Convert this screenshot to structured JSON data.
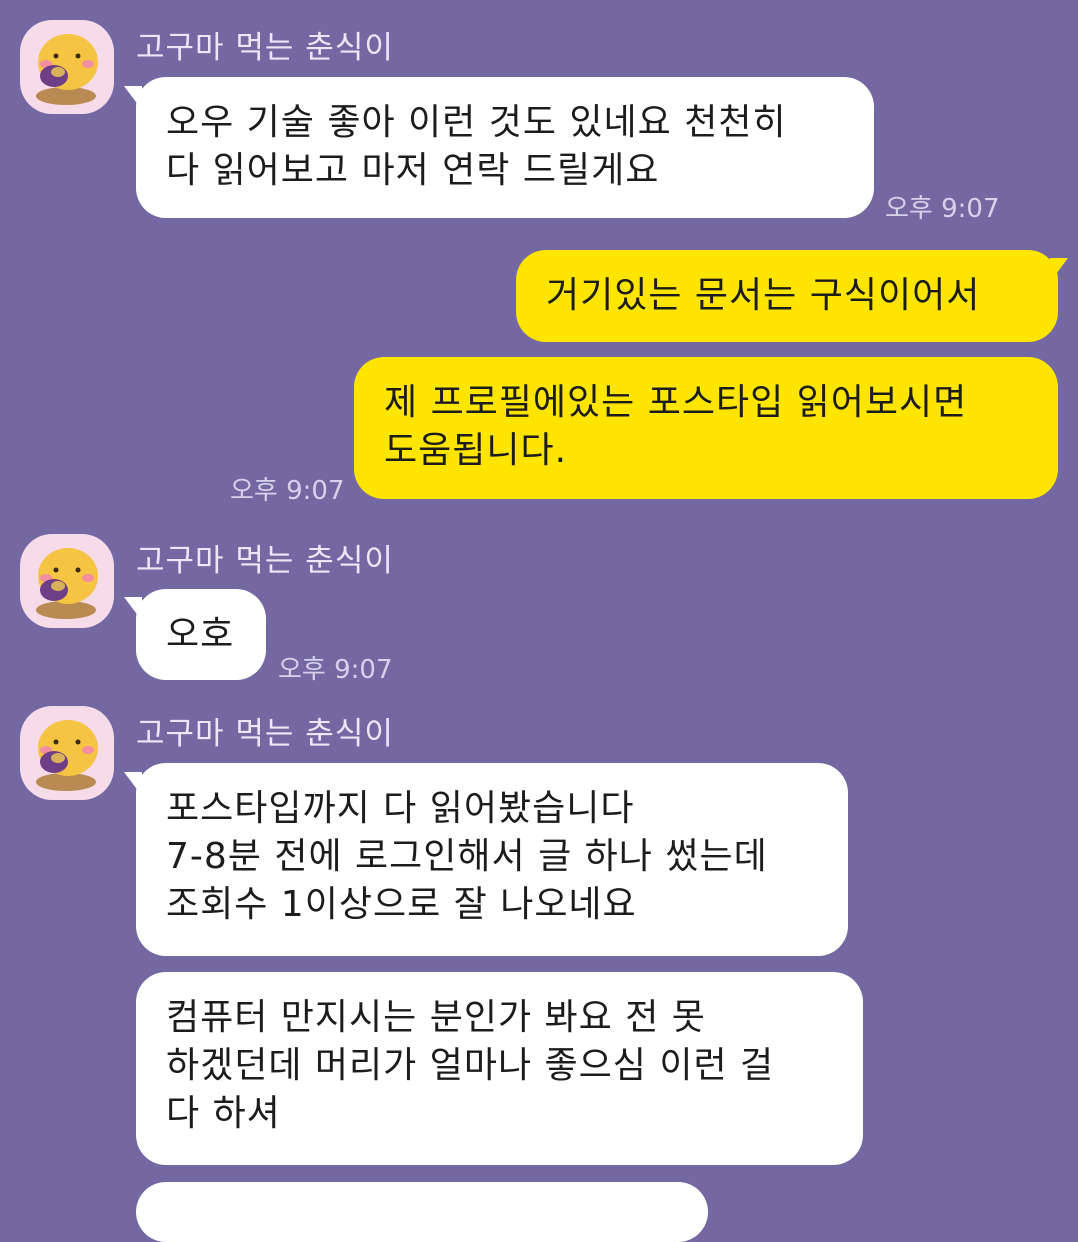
{
  "partner": {
    "name": "고구마 먹는 춘식이",
    "avatar_icon": "choonsik-sweet-potato-icon"
  },
  "messages": [
    {
      "side": "in",
      "text": "오우 기술 좋아 이런 것도 있네요 천천히\n다 읽어보고 마저 연락 드릴게요",
      "time": "오후 9:07"
    },
    {
      "side": "out",
      "text": "거기있는 문서는 구식이어서"
    },
    {
      "side": "out",
      "text": "제 프로필에있는 포스타입 읽어보시면\n도움됩니다.",
      "time": "오후 9:07"
    },
    {
      "side": "in",
      "text": "오호",
      "time": "오후 9:07"
    },
    {
      "side": "in",
      "text": "포스타입까지 다 읽어봤습니다\n7-8분 전에 로그인해서 글 하나 썼는데\n조회수 1이상으로 잘 나오네요"
    },
    {
      "side": "in",
      "text": "컴퓨터 만지시는 분인가 봐요 전 못\n하겠던데 머리가 얼마나 좋으심 이런 걸\n다 하셔"
    }
  ],
  "colors": {
    "background": "#7468a3",
    "incoming_bubble": "#ffffff",
    "outgoing_bubble": "#fee500",
    "avatar_bg": "#f6dbe9"
  }
}
